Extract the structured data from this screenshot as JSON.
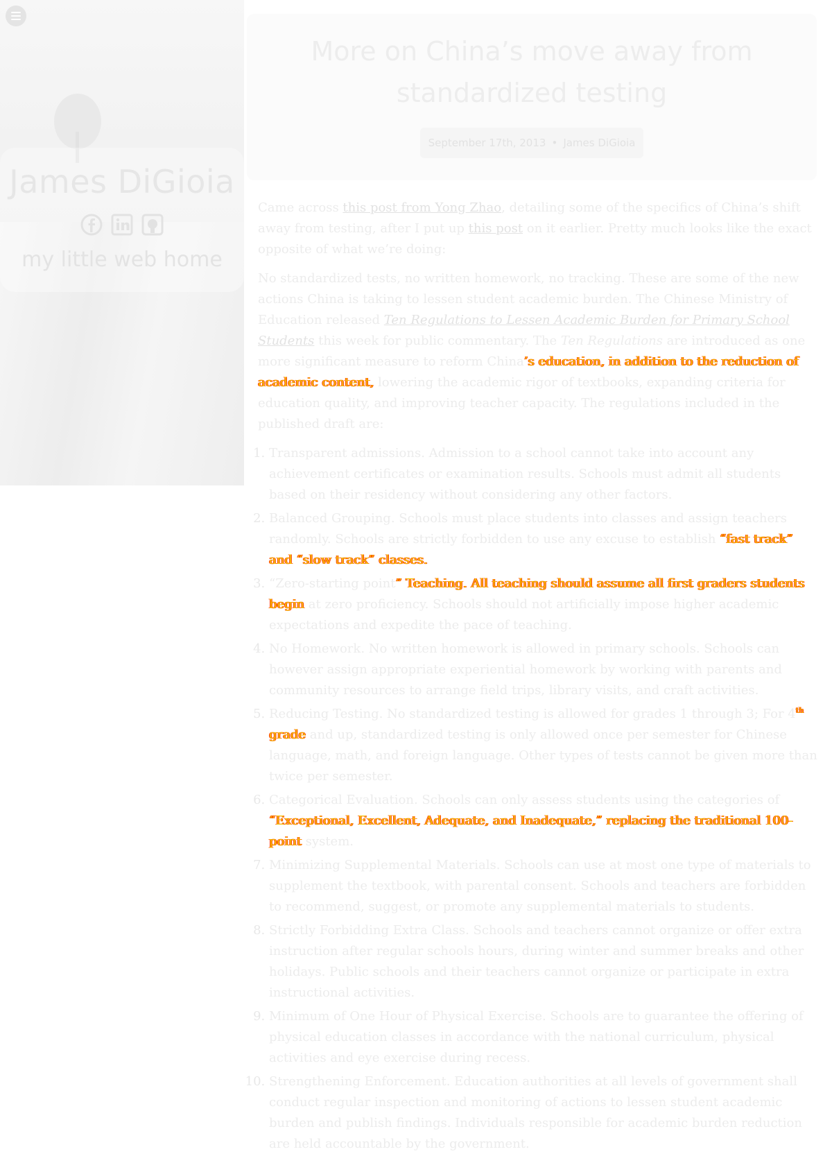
{
  "sidebar": {
    "site_title": "James DiGioia",
    "tagline": "my little web home",
    "menu_icon": "hamburger-menu-icon",
    "social_icons": [
      "facebook-icon",
      "linkedin-icon",
      "github-icon"
    ]
  },
  "post": {
    "title": "More on China’s move away from standardized testing",
    "date": "September 17th, 2013",
    "separator": "•",
    "author": "James DiGioia",
    "intro": {
      "before_link1": "Came across ",
      "link1": "this post from Yong Zhao",
      "between_links": ", detailing some of the specifics of China’s shift away from testing, after I put up ",
      "link2": "this post",
      "after_link2": " on it earlier. Pretty much looks like the exact opposite of what we’re doing:"
    },
    "quote_para1": "No standardized tests, no written homework, no tracking. These are some of the new actions China is taking to lessen student academic burden. The Chinese Ministry of Education released",
    "quote_link": "Ten Regulations to Lessen Academic Burden for Primary School Students",
    "quote_para1_after_link": " this week for public commentary. The ",
    "quote_em": "Ten Regulations",
    "quote_para1_mid": " are introduced as one more significant measure to reform China",
    "quote_para1_hl": "’s education, in addition to the reduction of academic content,",
    "quote_para1_end": "lowering the academic rigor of textbooks, expanding criteria for education quality, and improving teacher capacity. The regulations included in the published draft are:",
    "regulations": {
      "r1": "Transparent admissions. Admission to a school cannot take into account any achievement certificates or examination results. Schools must admit all students based on their residency without considering any other factors.",
      "r2_a": "Balanced Grouping. Schools must place students into classes and assign teachers randomly. Schools are strictly forbidden to use any excuse to establish ",
      "r2_hl": "“fast track” and “slow track” classes.",
      "r3_a": "“Zero-starting point",
      "r3_hl": "” Teaching. All teaching should assume all first graders students begin",
      "r3_b": " at zero proficiency. Schools should not artificially impose higher academic expectations and expedite the pace of teaching.",
      "r4": "No Homework. No written homework is allowed in primary schools. Schools can however assign appropriate experiential homework by working with parents and community resources to arrange field trips, library visits, and craft activities.",
      "r5_a": "Reducing Testing. No standardized testing is allowed for grades 1 through 3; For 4",
      "r5_sup": "th",
      "r5_hl": " grade",
      "r5_b": " and up, standardized testing is only allowed once per semester for Chinese language, math, and foreign language. Other types of tests cannot be given more than twice per semester.",
      "r6_a": "Categorical Evaluation. Schools can only assess students using the categories of ",
      "r6_hl": "“Exceptional, Excellent, Adequate, and Inadequate,” replacing the traditional 100-point",
      "r6_b": " system.",
      "r7": "Minimizing Supplemental Materials. Schools can use at most one type of materials to supplement the textbook, with parental consent. Schools and teachers are forbidden to recommend, suggest, or promote any supplemental materials to students.",
      "r8": "Strictly Forbidding Extra Class. Schools and teachers cannot organize or offer extra instruction after regular schools hours, during winter and summer breaks and other holidays. Public schools and their teachers cannot organize or participate in extra instructional activities.",
      "r9": "Minimum of One Hour of Physical Exercise. Schools are to guarantee the offering of physical education classes in accordance with the national curriculum, physical activities and eye exercise during recess.",
      "r10": "Strengthening Enforcement. Education authorities at all levels of government shall conduct regular inspection and monitoring of actions to lessen student academic burden and publish findings. Individuals responsible for academic burden reduction are held accountable by the government."
    }
  },
  "colors": {
    "highlight_text": "#f2c200",
    "highlight_outline": "#ff3b00"
  }
}
